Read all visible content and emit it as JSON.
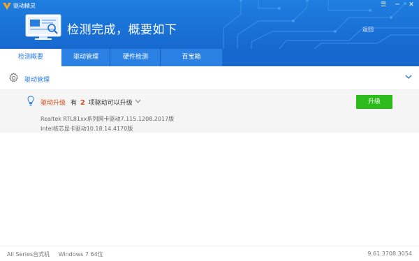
{
  "app": {
    "title": "驱动精灵",
    "window_controls": [
      "☰",
      "─",
      "✕"
    ]
  },
  "header": {
    "headline": "检测完成，概要如下",
    "back_label": "返回"
  },
  "tabs": [
    {
      "label": "检测概要",
      "active": true
    },
    {
      "label": "驱动管理",
      "active": false
    },
    {
      "label": "硬件检测",
      "active": false
    },
    {
      "label": "百宝箱",
      "active": false
    }
  ],
  "section": {
    "title": "驱动管理",
    "gear_icon": "gear-icon",
    "collapse_icon": "chevron-down-icon"
  },
  "upgrade": {
    "label": "驱动升级",
    "summary_prefix": "有",
    "count": "2",
    "summary_suffix": "项驱动可以升级",
    "button_label": "升级",
    "drivers": [
      "Realtek RTL81xx系列网卡驱动7.115.1208.2017版",
      "Intel核芯显卡驱动10.18.14.4170版"
    ]
  },
  "status": {
    "machine": "All Series台式机",
    "os": "Windows 7 64位",
    "version": "9.61.3708.3054"
  },
  "colors": {
    "header_blue": "#1668cf",
    "accent_blue": "#2a7be0",
    "alert_orange": "#d84a1b",
    "button_green": "#2cbb1a"
  }
}
